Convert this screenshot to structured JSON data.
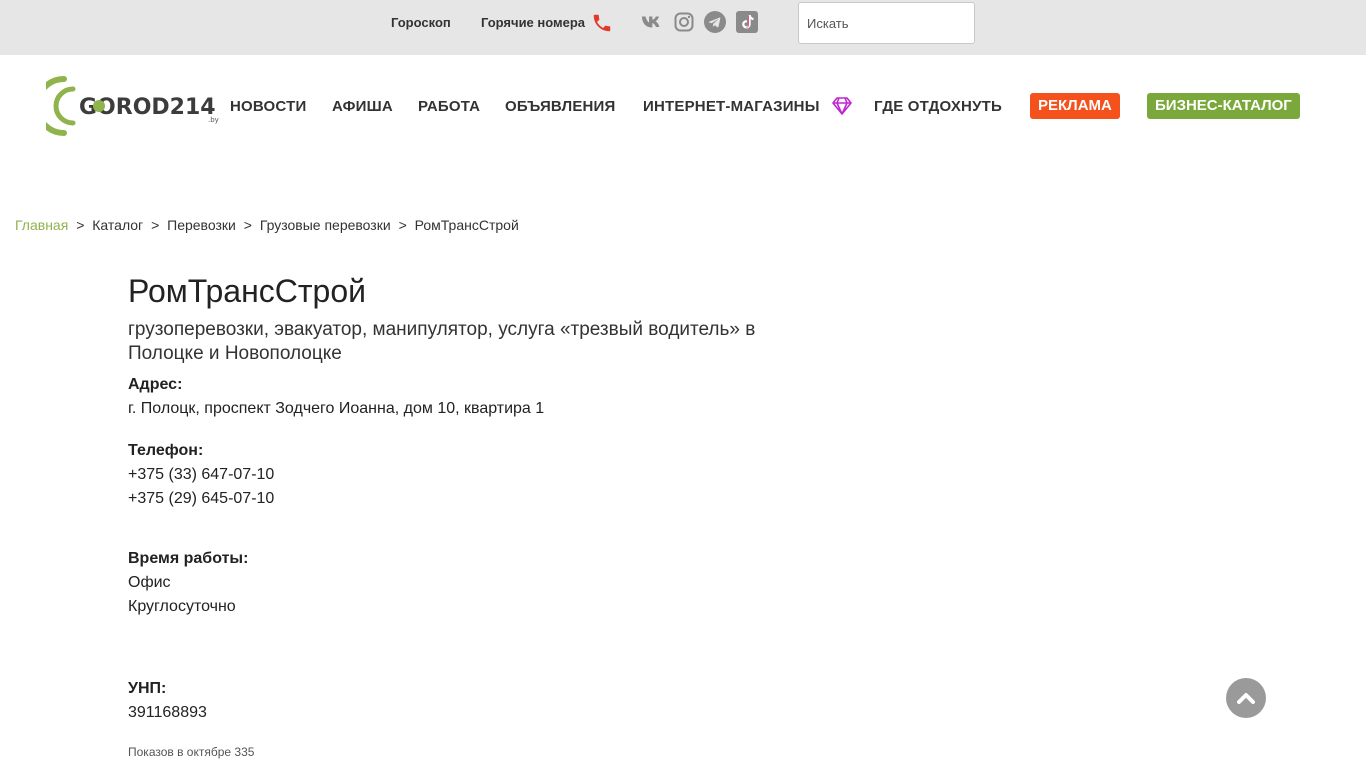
{
  "topbar": {
    "horoscope_label": "Гороскоп",
    "hot_numbers_label": "Горячие номера",
    "search_placeholder": "Искать",
    "social": [
      "vk-icon",
      "instagram-icon",
      "telegram-icon",
      "tiktok-icon"
    ]
  },
  "header": {
    "logo_text": "GOROD214",
    "logo_sub": ".by",
    "nav": [
      "НОВОСТИ",
      "АФИША",
      "РАБОТА",
      "ОБЪЯВЛЕНИЯ",
      "ИНТЕРНЕТ-МАГАЗИНЫ",
      "ГДЕ ОТДОХНУТЬ"
    ],
    "ad_label": "РЕКЛАМА",
    "catalog_label": "БИЗНЕС-КАТАЛОГ"
  },
  "breadcrumb": {
    "home": "Главная",
    "separator": ">",
    "items": [
      "Каталог",
      "Перевозки",
      "Грузовые перевозки",
      "РомТрансСтрой"
    ]
  },
  "company": {
    "name": "РомТрансСтрой",
    "description": "грузоперевозки, эвакуатор, манипулятор, услуга «трезвый водитель» в Полоцке и Новополоцке",
    "address_label": "Адрес:",
    "address": "г. Полоцк, проспект Зодчего Иоанна, дом 10, квартира 1",
    "phone_label": "Телефон:",
    "phones": [
      "+375 (33) 647-07-10",
      "+375 (29) 645-07-10"
    ],
    "hours_label": "Время работы:",
    "hours_place": "Офис",
    "hours_value": "Круглосуточно",
    "unp_label": "УНП:",
    "unp": "391168893",
    "views": "Показов в октябре 335"
  },
  "colors": {
    "accent_green": "#8fb34d",
    "ad_orange": "#f5511c",
    "catalog_green": "#7aa83a"
  }
}
